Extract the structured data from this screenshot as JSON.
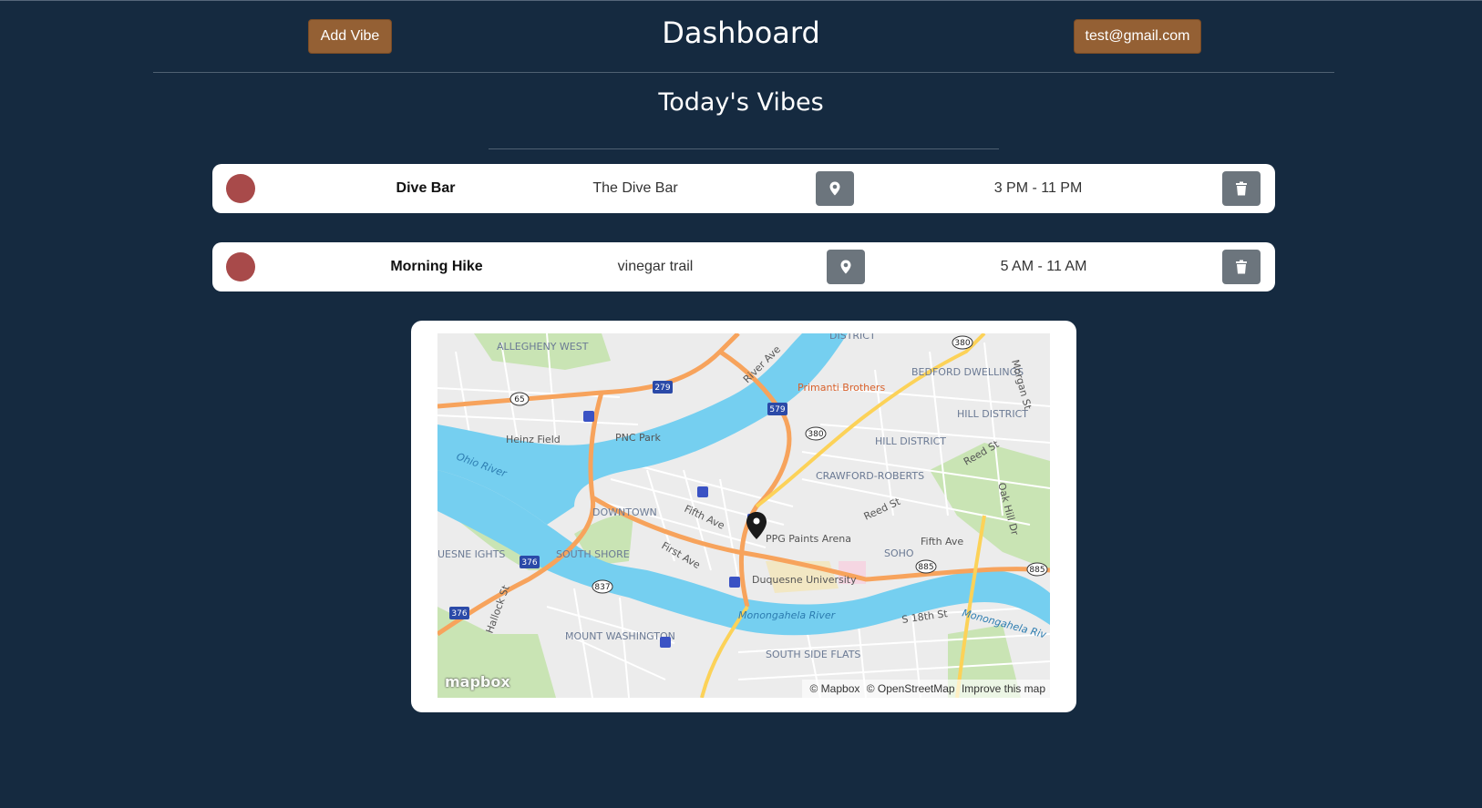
{
  "header": {
    "add_button": "Add Vibe",
    "title": "Dashboard",
    "user_button": "test@gmail.com"
  },
  "section_title": "Today's Vibes",
  "vibes": [
    {
      "name": "Dive Bar",
      "location": "The Dive Bar",
      "time": "3 PM - 11 PM",
      "icon": "location-pin-icon",
      "status_color": "#a84a4a"
    },
    {
      "name": "Morning Hike",
      "location": "vinegar trail",
      "time": "5 AM - 11 AM",
      "icon": "location-pin-icon",
      "status_color": "#a84a4a"
    }
  ],
  "map": {
    "labels": {
      "allegheny_west": "ALLEGHENY WEST",
      "district": "DISTRICT",
      "bedford_dwellings": "BEDFORD DWELLINGS",
      "primanti": "Primanti Brothers",
      "hill_district_1": "HILL DISTRICT",
      "hill_district_2": "HILL DISTRICT",
      "crawford_roberts": "CRAWFORD-ROBERTS",
      "heinz_field": "Heinz Field",
      "pnc_park": "PNC Park",
      "ohio_river": "Ohio River",
      "downtown": "DOWNTOWN",
      "fifth_ave_1": "Fifth Ave",
      "fifth_ave_2": "Fifth Ave",
      "first_ave": "First Ave",
      "ppg": "PPG Paints Arena",
      "soho": "SOHO",
      "duquesne": "Duquesne University",
      "south_shore": "SOUTH SHORE",
      "duquesne_heights": "UESNE IGHTS",
      "monongahela_1": "Monongahela River",
      "monongahela_2": "Monongahela Riv",
      "mount_washington": "MOUNT WASHINGTON",
      "south_side_flats": "SOUTH SIDE FLATS",
      "river_ave": "River Ave",
      "reed_st_1": "Reed St",
      "reed_st_2": "Reed St",
      "morgan_st": "Morgan St",
      "oak_hill": "Oak Hill Dr",
      "s18th": "S 18th St",
      "hallock": "Hallock St"
    },
    "shields": [
      "380",
      "380",
      "65",
      "279",
      "579",
      "376",
      "376",
      "837",
      "885",
      "885"
    ],
    "logo": "mapbox",
    "attribution": [
      "© Mapbox",
      "© OpenStreetMap",
      "Improve this map"
    ],
    "colors": {
      "water": "#75cff0",
      "road": "#f7a35c",
      "land": "#ececec",
      "park": "#c9e4b4"
    }
  }
}
